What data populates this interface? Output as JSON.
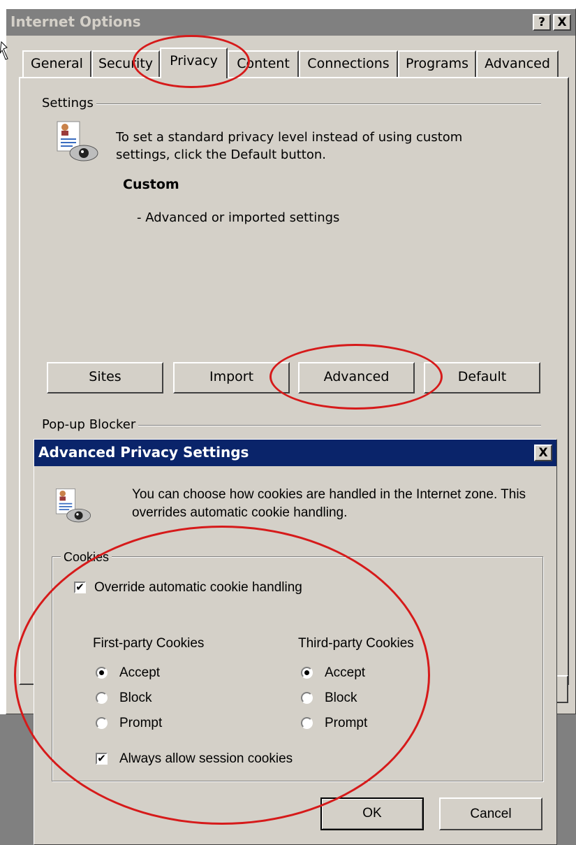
{
  "internet_options": {
    "title": "Internet Options",
    "help_label": "?",
    "close_label": "X",
    "tabs": [
      "General",
      "Security",
      "Privacy",
      "Content",
      "Connections",
      "Programs",
      "Advanced"
    ],
    "active_tab": "Privacy",
    "settings_group_label": "Settings",
    "privacy_description": "To set a standard privacy level instead of using custom settings, click the Default button.",
    "level_name": "Custom",
    "level_detail": "- Advanced or imported settings",
    "buttons": {
      "sites": "Sites",
      "import": "Import",
      "advanced": "Advanced",
      "default": "Default"
    },
    "popup_group_label": "Pop-up Blocker"
  },
  "advanced_privacy": {
    "title": "Advanced Privacy Settings",
    "close_label": "X",
    "description": "You can choose how cookies are handled in the Internet zone.  This overrides automatic cookie handling.",
    "cookies_group_label": "Cookies",
    "override_label": "Override automatic cookie handling",
    "override_checked": true,
    "first_party": {
      "heading": "First-party Cookies",
      "options": [
        "Accept",
        "Block",
        "Prompt"
      ],
      "selected": "Accept"
    },
    "third_party": {
      "heading": "Third-party Cookies",
      "options": [
        "Accept",
        "Block",
        "Prompt"
      ],
      "selected": "Accept"
    },
    "session_label": "Always allow session cookies",
    "session_checked": true,
    "ok_label": "OK",
    "cancel_label": "Cancel"
  },
  "colors": {
    "dialog_face": "#d4d0c8",
    "active_title": "#0a246a",
    "inactive_title": "#808080",
    "annotation_red": "#d61a1a"
  }
}
